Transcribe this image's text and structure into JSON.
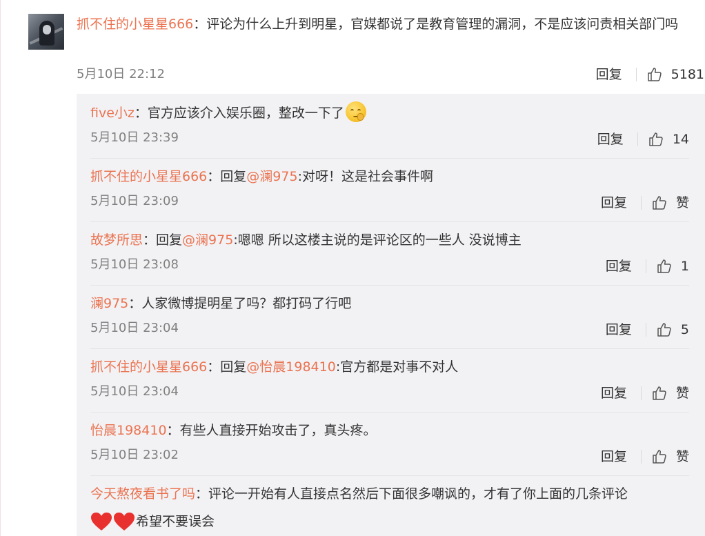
{
  "main_comment": {
    "username": "抓不住的小星星666",
    "separator": "：",
    "text": "评论为什么上升到明星，官媒都说了是教育管理的漏洞，不是应该问责相关部门吗",
    "time": "5月10日 22:12",
    "reply_label": "回复",
    "likes": "5181"
  },
  "replies": [
    {
      "username": "five小z",
      "separator": "：",
      "prefix": "",
      "at": "",
      "text": "官方应该介入娱乐圈，整改一下了",
      "emoji": "shushing-face-icon",
      "time": "5月10日 23:39",
      "reply_label": "回复",
      "likes": "14"
    },
    {
      "username": "抓不住的小星星666",
      "separator": "：",
      "prefix": "回复",
      "at": "@澜975",
      "text": ":对呀！这是社会事件啊",
      "time": "5月10日 23:09",
      "reply_label": "回复",
      "likes": "赞"
    },
    {
      "username": "故梦所思",
      "separator": "：",
      "prefix": "回复",
      "at": "@澜975",
      "text": ":嗯嗯 所以这楼主说的是评论区的一些人 没说博主",
      "time": "5月10日 23:08",
      "reply_label": "回复",
      "likes": "1"
    },
    {
      "username": "澜975",
      "separator": "：",
      "prefix": "",
      "at": "",
      "text": "人家微博提明星了吗？都打码了行吧",
      "time": "5月10日 23:04",
      "reply_label": "回复",
      "likes": "5"
    },
    {
      "username": "抓不住的小星星666",
      "separator": "：",
      "prefix": "回复",
      "at": "@怡晨198410",
      "text": ":官方都是对事不对人",
      "time": "5月10日 23:04",
      "reply_label": "回复",
      "likes": "赞"
    },
    {
      "username": "怡晨198410",
      "separator": "：",
      "prefix": "",
      "at": "",
      "text": "有些人直接开始攻击了，真头疼。",
      "time": "5月10日 23:02",
      "reply_label": "回复",
      "likes": "赞"
    },
    {
      "username": "今天熬夜看书了吗",
      "separator": "：",
      "prefix": "",
      "at": "",
      "text": "评论一开始有人直接点名然后下面很多嘲讽的，才有了你上面的几条评论",
      "suffix": "希望不要误会",
      "emoji": "red-heart-icon"
    }
  ],
  "colors": {
    "username": "#eb7350",
    "text": "#333333",
    "time": "#808080",
    "sub_background": "#f2f2f5",
    "heart": "#e8312f"
  }
}
